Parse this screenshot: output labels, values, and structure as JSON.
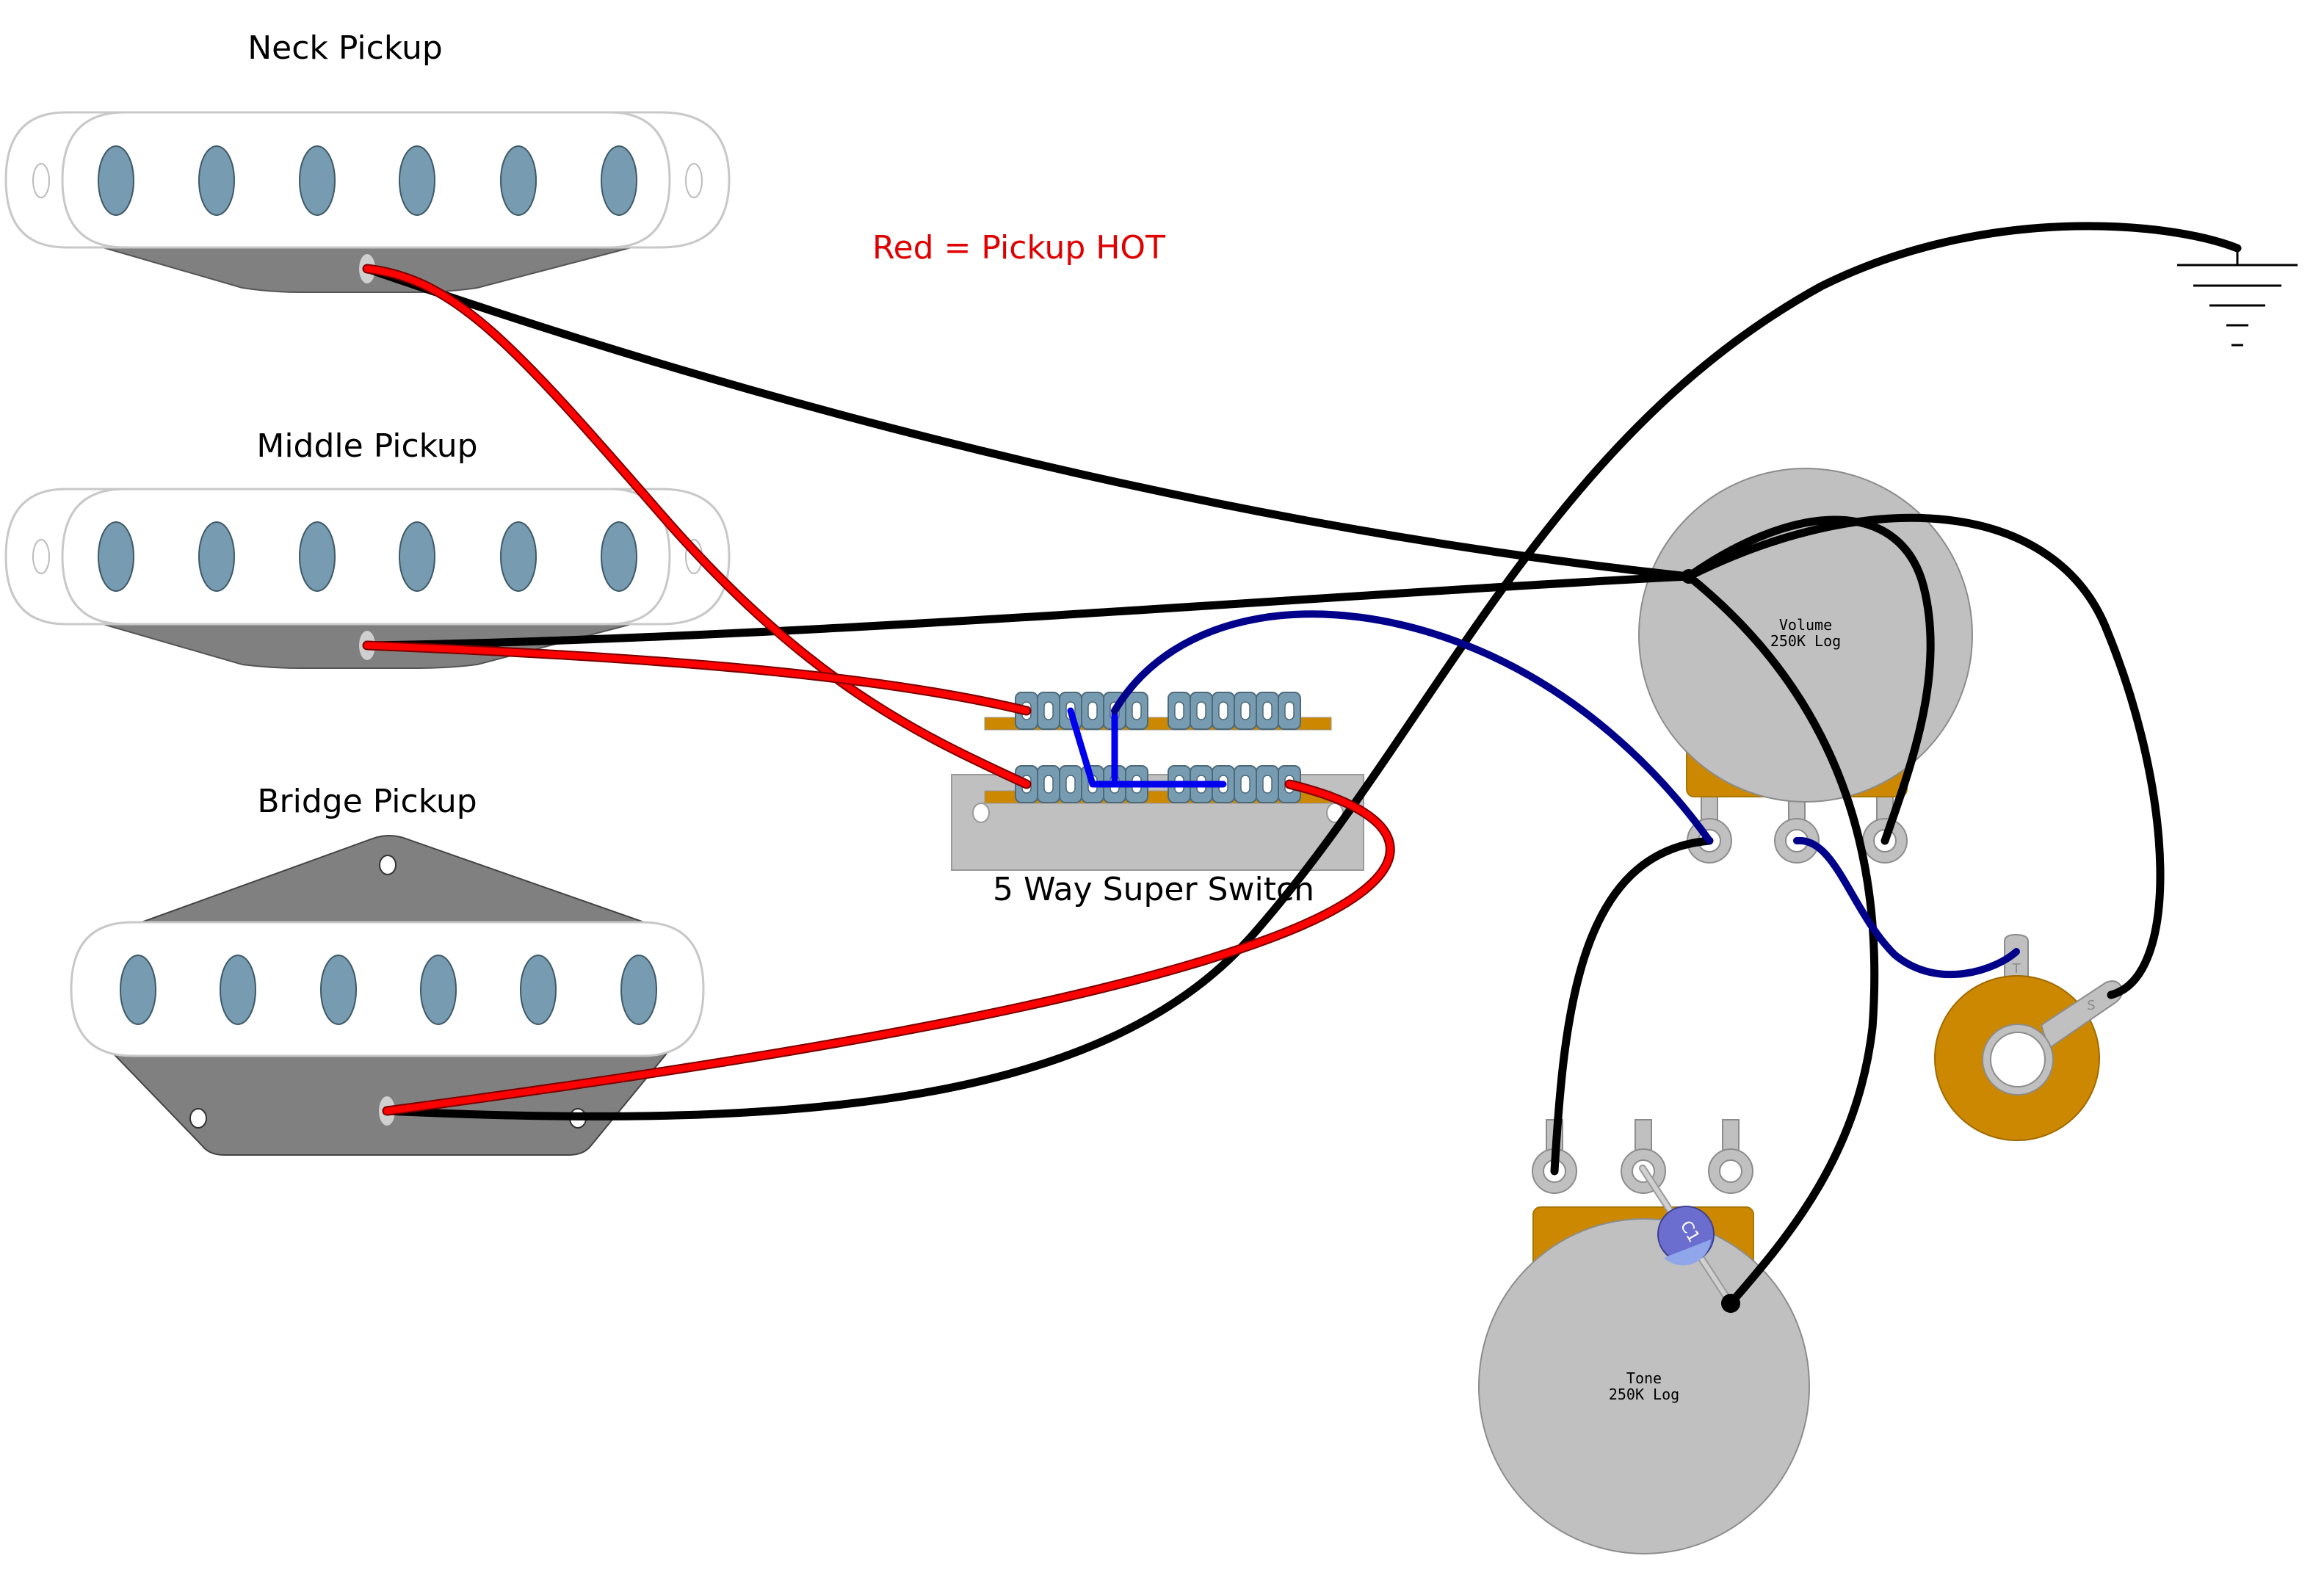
{
  "diagram": {
    "title_note": "Red = Pickup HOT",
    "colors": {
      "hot_wire": "#ff0000",
      "ground_wire": "#000000",
      "signal_wire": "#00008b",
      "jumper_wire": "#0000ee",
      "pickup_cover": "#ffffff",
      "pole_piece": "#779bb0",
      "baseplate": "#808080",
      "pot_body": "#c0c0c0",
      "pot_base": "#cc8800",
      "capacitor": "#6b6ecf",
      "note_text": "#e00000"
    },
    "pickups": [
      {
        "id": "neck",
        "label": "Neck Pickup",
        "type": "single-coil",
        "pole_count": 6
      },
      {
        "id": "middle",
        "label": "Middle Pickup",
        "type": "single-coil",
        "pole_count": 6
      },
      {
        "id": "bridge",
        "label": "Bridge Pickup",
        "type": "tele-bridge",
        "pole_count": 6
      }
    ],
    "switch": {
      "label": "5 Way Super Switch",
      "lugs_per_row": 12,
      "rows": 2
    },
    "pots": [
      {
        "id": "volume",
        "name": "Volume",
        "value": "250K Log"
      },
      {
        "id": "tone",
        "name": "Tone",
        "value": "250K Log"
      }
    ],
    "capacitor": {
      "label": "C1"
    },
    "jack": {
      "tip_label": "T",
      "sleeve_label": "S"
    },
    "ground": {
      "symbol": "ground-icon"
    }
  }
}
